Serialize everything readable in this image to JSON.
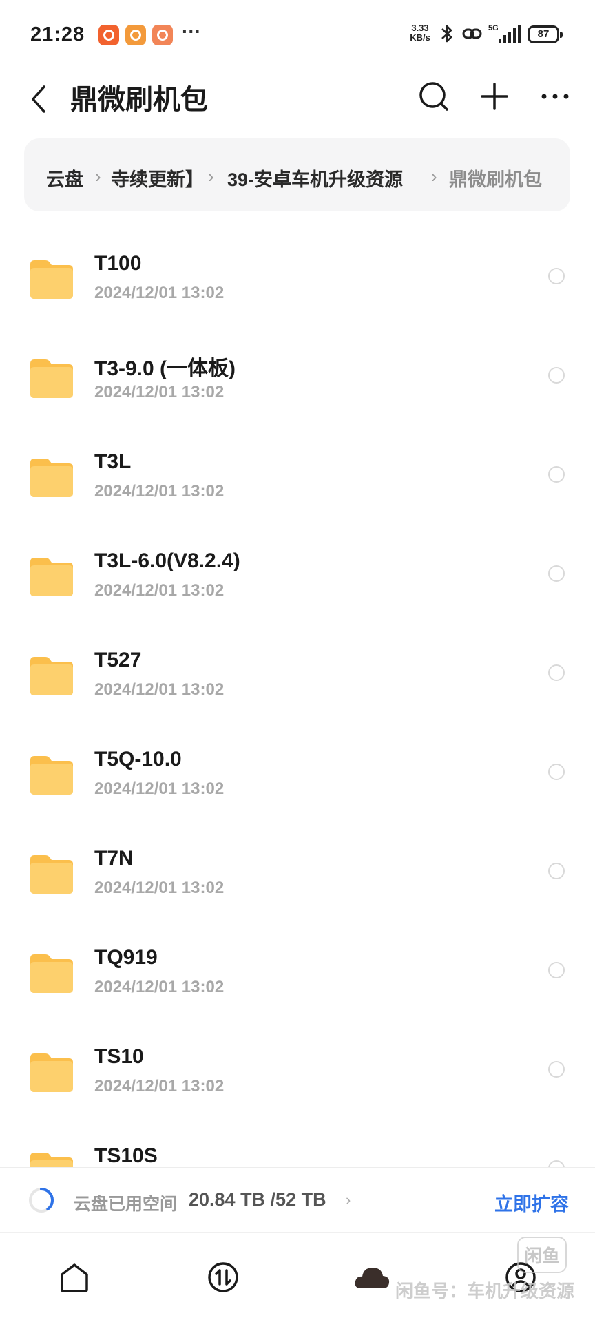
{
  "status_bar": {
    "time": "21:28",
    "more": "···",
    "net_speed_value": "3.33",
    "net_speed_unit": "KB/s",
    "network_type": "5G",
    "battery": "87"
  },
  "header": {
    "title": "鼎微刷机包",
    "icons": [
      "back-icon",
      "search-icon",
      "add-icon",
      "more-icon"
    ]
  },
  "breadcrumb": {
    "items": [
      "云盘",
      "寺续更新】",
      "39-安卓车机升级资源",
      "鼎微刷机包"
    ],
    "separator": "›"
  },
  "files": [
    {
      "name": "T100",
      "date": "2024/12/01 13:02"
    },
    {
      "name": "T3-9.0 (一体板)",
      "date": "2024/12/01 13:02"
    },
    {
      "name": "T3L",
      "date": "2024/12/01 13:02"
    },
    {
      "name": "T3L-6.0(V8.2.4)",
      "date": "2024/12/01 13:02"
    },
    {
      "name": "T527",
      "date": "2024/12/01 13:02"
    },
    {
      "name": "T5Q-10.0",
      "date": "2024/12/01 13:02"
    },
    {
      "name": "T7N",
      "date": "2024/12/01 13:02"
    },
    {
      "name": "TQ919",
      "date": "2024/12/01 13:02"
    },
    {
      "name": "TS10",
      "date": "2024/12/01 13:02"
    },
    {
      "name": "TS10S",
      "date": ""
    }
  ],
  "storage": {
    "label": "云盘已用空间",
    "value": "20.84 TB /52 TB",
    "arrow": "›",
    "used_fraction": 0.4,
    "expand_label": "立即扩容",
    "accent_color": "#2f73e8"
  },
  "bottom_nav": {
    "items": [
      "home-icon",
      "transfer-icon",
      "cloud-icon",
      "profile-icon"
    ],
    "active": "cloud-icon"
  },
  "watermark": {
    "logo": "闲鱼",
    "text": "闲鱼号：车机升级资源"
  }
}
